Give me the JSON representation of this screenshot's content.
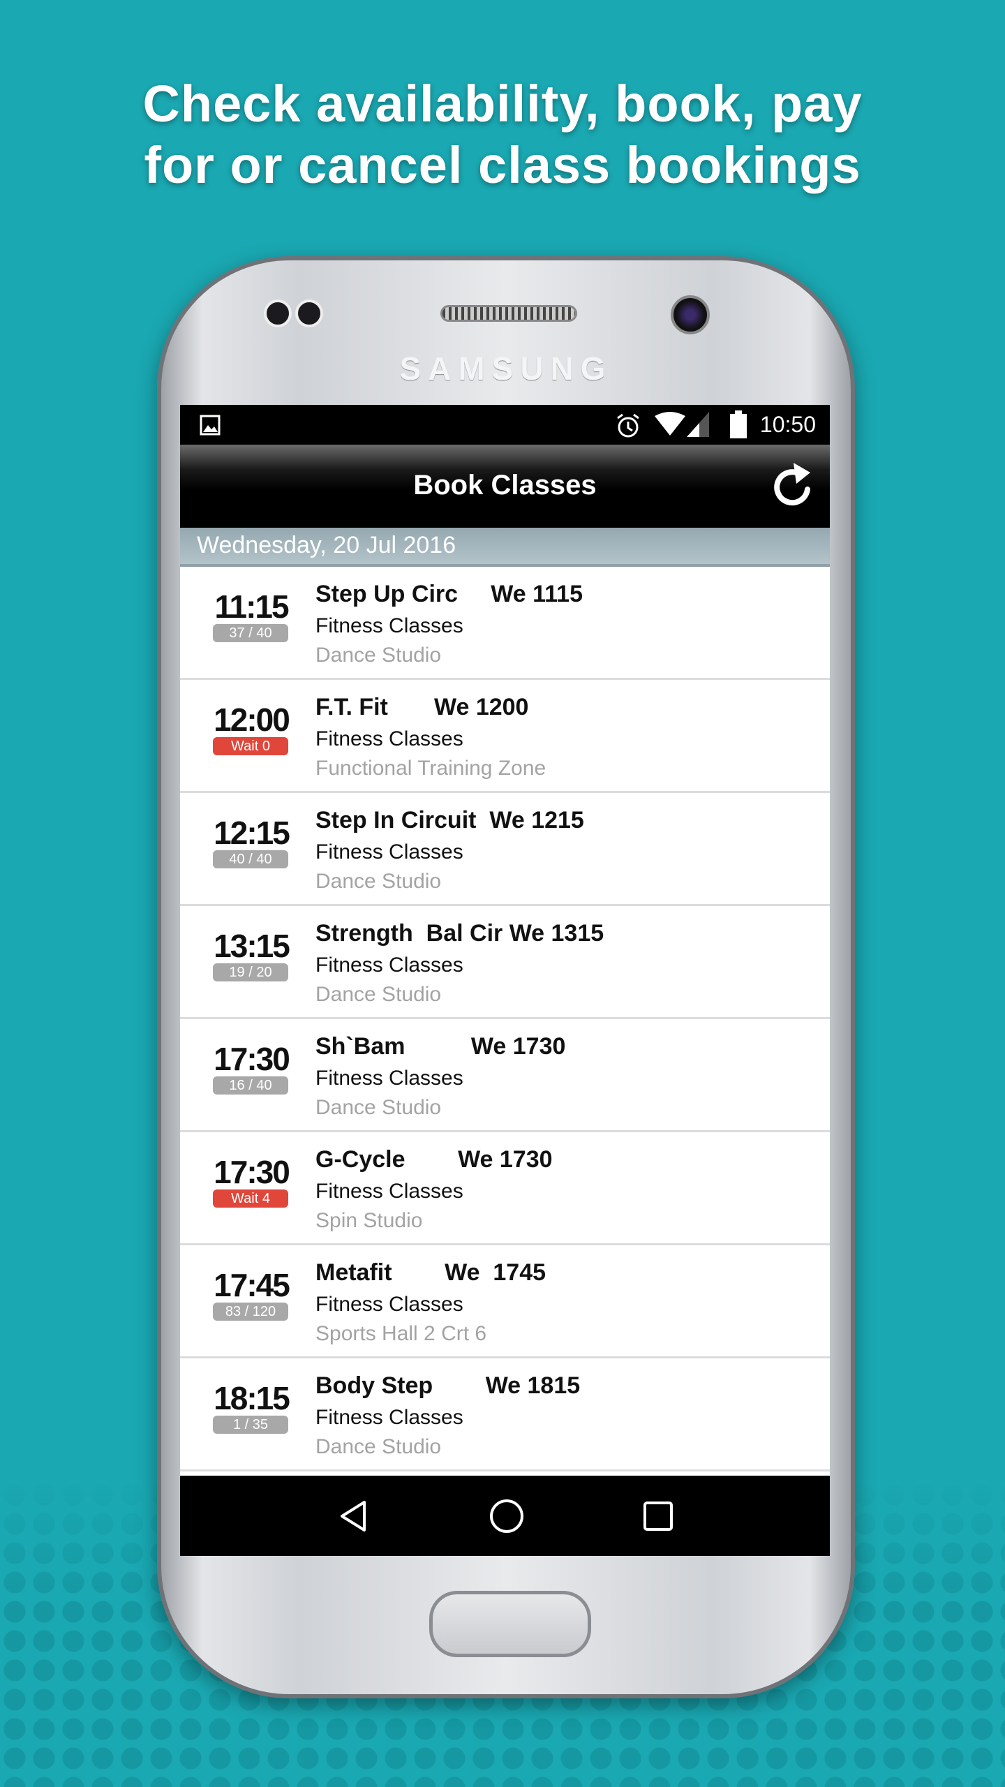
{
  "headline": {
    "line1": "Check availability, book, pay",
    "line2": "for or cancel class bookings"
  },
  "device": {
    "brand": "SAMSUNG"
  },
  "status_bar": {
    "time": "10:50",
    "icons": [
      "image-icon",
      "alarm-icon",
      "wifi-icon",
      "signal-icon",
      "battery-icon"
    ]
  },
  "header": {
    "title": "Book Classes",
    "refresh_icon": "refresh-icon"
  },
  "date": "Wednesday, 20 Jul 2016",
  "colors": {
    "background": "#1aa8b2",
    "wait_badge": "#e0463a",
    "capacity_badge": "#a8a8a8"
  },
  "classes": [
    {
      "time": "11:15",
      "badge": "37 / 40",
      "wait": false,
      "name": "Step Up Circ     We 1115",
      "category": "Fitness Classes",
      "location": "Dance Studio"
    },
    {
      "time": "12:00",
      "badge": "Wait 0",
      "wait": true,
      "name": "F.T. Fit       We 1200",
      "category": "Fitness Classes",
      "location": "Functional Training Zone"
    },
    {
      "time": "12:15",
      "badge": "40 / 40",
      "wait": false,
      "name": "Step In Circuit  We 1215",
      "category": "Fitness Classes",
      "location": "Dance Studio"
    },
    {
      "time": "13:15",
      "badge": "19 / 20",
      "wait": false,
      "name": "Strength  Bal Cir We 1315",
      "category": "Fitness Classes",
      "location": "Dance Studio"
    },
    {
      "time": "17:30",
      "badge": "16 / 40",
      "wait": false,
      "name": "Sh`Bam          We 1730",
      "category": "Fitness Classes",
      "location": "Dance Studio"
    },
    {
      "time": "17:30",
      "badge": "Wait 4",
      "wait": true,
      "name": "G-Cycle        We 1730",
      "category": "Fitness Classes",
      "location": "Spin Studio"
    },
    {
      "time": "17:45",
      "badge": "83 / 120",
      "wait": false,
      "name": "Metafit        We  1745",
      "category": "Fitness Classes",
      "location": "Sports Hall 2 Crt 6"
    },
    {
      "time": "18:15",
      "badge": "1 / 35",
      "wait": false,
      "name": "Body Step        We 1815",
      "category": "Fitness Classes",
      "location": "Dance Studio"
    }
  ],
  "nav": {
    "icons": [
      "back-icon",
      "home-icon",
      "recents-icon"
    ]
  }
}
